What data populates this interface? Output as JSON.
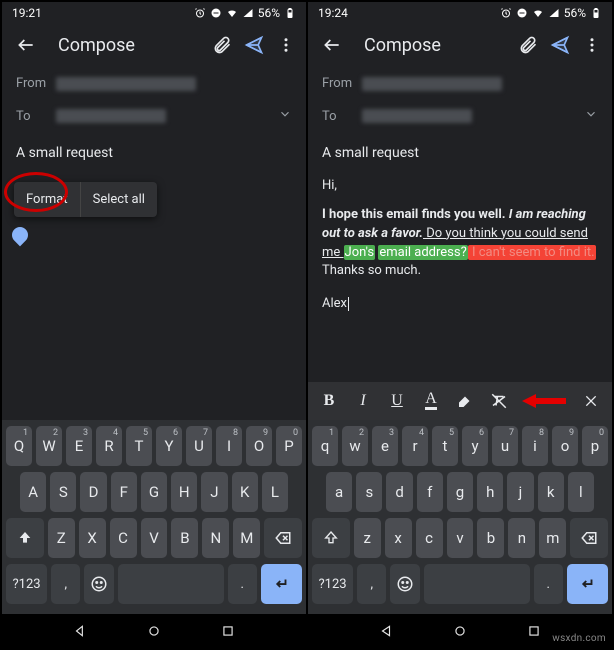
{
  "left": {
    "status": {
      "time": "19:21",
      "battery": "56%"
    },
    "appbar": {
      "title": "Compose"
    },
    "fields": {
      "from_label": "From",
      "to_label": "To"
    },
    "subject": "A small request",
    "context_menu": {
      "format": "Format",
      "select_all": "Select all"
    }
  },
  "right": {
    "status": {
      "time": "19:24",
      "battery": "56%"
    },
    "appbar": {
      "title": "Compose"
    },
    "fields": {
      "from_label": "From",
      "to_label": "To"
    },
    "subject": "A small request",
    "body": {
      "greeting": "Hi,",
      "line_bold": "I hope this email finds you well.",
      "line_bold_italic": " I am reaching out to ask a favor.",
      "line_underline": " Do you think you could send me ",
      "hl_green_1": "Jon's",
      "hl_green_2": "email address?",
      "red_text": " I can't seem to find it.",
      "plain_tail": " Thanks so much.",
      "signoff": "Alex"
    },
    "format_toolbar": {
      "bold": "B",
      "italic": "I",
      "underline": "U",
      "color": "A",
      "highlight": "⯃",
      "clear": "✕"
    }
  },
  "keyboard": {
    "upper": {
      "row1": [
        {
          "k": "Q",
          "s": "1"
        },
        {
          "k": "W",
          "s": "2"
        },
        {
          "k": "E",
          "s": "3"
        },
        {
          "k": "R",
          "s": "4"
        },
        {
          "k": "T",
          "s": "5"
        },
        {
          "k": "Y",
          "s": "6"
        },
        {
          "k": "U",
          "s": "7"
        },
        {
          "k": "I",
          "s": "8"
        },
        {
          "k": "O",
          "s": "9"
        },
        {
          "k": "P",
          "s": "0"
        }
      ],
      "row2": [
        "A",
        "S",
        "D",
        "F",
        "G",
        "H",
        "J",
        "K",
        "L"
      ],
      "row3": [
        "Z",
        "X",
        "C",
        "V",
        "B",
        "N",
        "M"
      ]
    },
    "lower": {
      "row1": [
        {
          "k": "q",
          "s": "1"
        },
        {
          "k": "w",
          "s": "2"
        },
        {
          "k": "e",
          "s": "3"
        },
        {
          "k": "r",
          "s": "4"
        },
        {
          "k": "t",
          "s": "5"
        },
        {
          "k": "y",
          "s": "6"
        },
        {
          "k": "u",
          "s": "7"
        },
        {
          "k": "i",
          "s": "8"
        },
        {
          "k": "o",
          "s": "9"
        },
        {
          "k": "p",
          "s": "0"
        }
      ],
      "row2": [
        "a",
        "s",
        "d",
        "f",
        "g",
        "h",
        "j",
        "k",
        "l"
      ],
      "row3": [
        "z",
        "x",
        "c",
        "v",
        "b",
        "n",
        "m"
      ]
    },
    "bottom": {
      "symbols": "?123",
      "comma": ",",
      "period": "."
    }
  },
  "watermark": "wsxdn.com"
}
